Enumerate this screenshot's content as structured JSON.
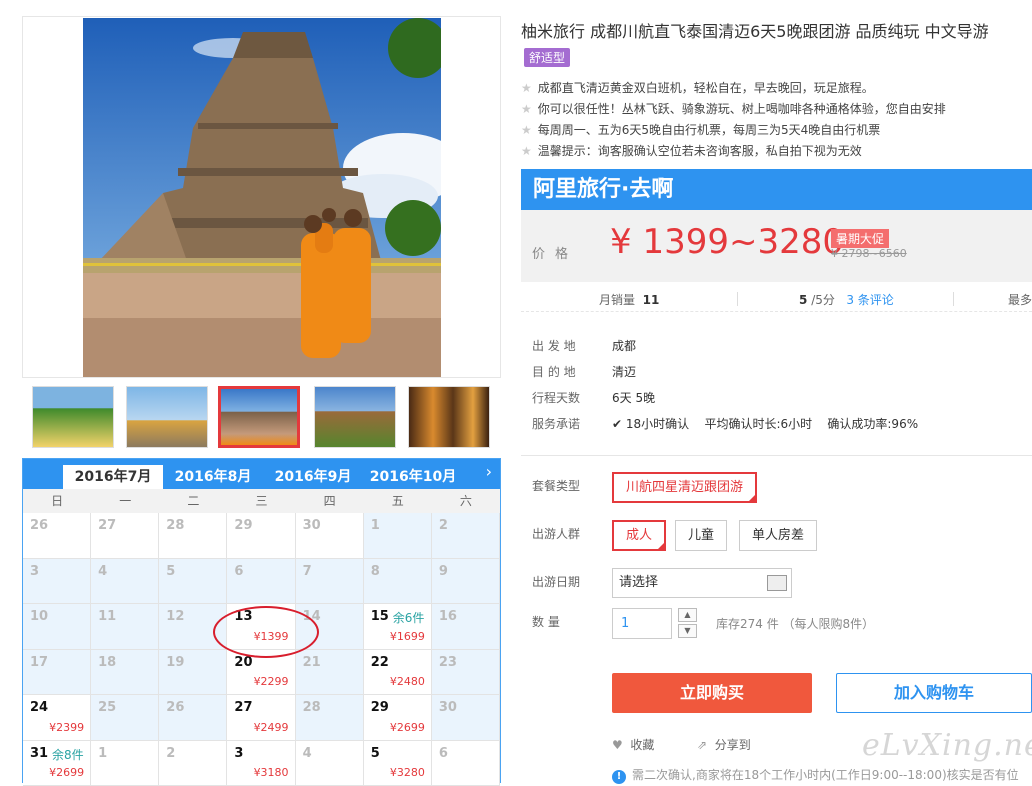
{
  "product": {
    "title": "柚米旅行 成都川航直飞泰国清迈6天5晚跟团游 品质纯玩 中文导游",
    "badge": "舒适型",
    "features": [
      "成都直飞清迈黄金双白班机，轻松自在，早去晚回，玩足旅程。",
      "你可以很任性！丛林飞跃、骑象游玩、树上喝咖啡各种通格体验，您自由安排",
      "每周周一、五为6天5晚自由行机票，每周三为5天4晚自由行机票",
      "温馨提示：询客服确认空位若未咨询客服，私自拍下视为无效"
    ]
  },
  "banner": {
    "brand": "阿里旅行·去啊"
  },
  "price": {
    "label": "价格",
    "range": "¥ 1399~3280",
    "promo": "暑期大促",
    "original": "¥ 2798~6560"
  },
  "stats": {
    "monthly_sales_label": "月销量",
    "monthly_sales": "11",
    "score": "5",
    "score_unit": "/5分",
    "reviews": "3 条评论",
    "more": "最多"
  },
  "details": [
    {
      "label": "出 发 地",
      "value": "成都"
    },
    {
      "label": "目 的 地",
      "value": "清迈"
    },
    {
      "label": "行程天数",
      "value": "6天 5晚"
    },
    {
      "label": "服务承诺",
      "value": "18小时确认"
    }
  ],
  "service_extra": [
    "平均确认时长:6小时",
    "确认成功率:96%"
  ],
  "options": {
    "package_label": "套餐类型",
    "package_value": "川航四星清迈跟团游",
    "people_label": "出游人群",
    "people": [
      "成人",
      "儿童",
      "单人房差"
    ],
    "date_label": "出游日期",
    "date_placeholder": "请选择",
    "qty_label": "数 量",
    "qty_value": "1",
    "stock": "库存274 件 （每人限购8件）"
  },
  "actions": {
    "buy": "立即购买",
    "cart": "加入购物车",
    "favorite": "收藏",
    "share": "分享到"
  },
  "notice": "需二次确认,商家将在18个工作小时内(工作日9:00--18:00)核实是否有位",
  "watermark": "eLvXing.net",
  "calendar": {
    "months": [
      "2016年7月",
      "2016年8月",
      "2016年9月",
      "2016年10月"
    ],
    "next": "›",
    "weekdays": [
      "日",
      "一",
      "二",
      "三",
      "四",
      "五",
      "六"
    ],
    "weeks": [
      [
        {
          "d": "26"
        },
        {
          "d": "27"
        },
        {
          "d": "28"
        },
        {
          "d": "29"
        },
        {
          "d": "30"
        },
        {
          "d": "1",
          "off": true
        },
        {
          "d": "2",
          "off": true
        }
      ],
      [
        {
          "d": "3",
          "off": true
        },
        {
          "d": "4",
          "off": true
        },
        {
          "d": "5",
          "off": true
        },
        {
          "d": "6",
          "off": true
        },
        {
          "d": "7",
          "off": true
        },
        {
          "d": "8",
          "off": true
        },
        {
          "d": "9",
          "off": true
        }
      ],
      [
        {
          "d": "10",
          "off": true
        },
        {
          "d": "11",
          "off": true
        },
        {
          "d": "12",
          "off": true
        },
        {
          "d": "13",
          "on": true,
          "price": "¥1399"
        },
        {
          "d": "14",
          "off": true
        },
        {
          "d": "15",
          "on": true,
          "stock": "余6件",
          "price": "¥1699"
        },
        {
          "d": "16",
          "off": true
        }
      ],
      [
        {
          "d": "17",
          "off": true
        },
        {
          "d": "18",
          "off": true
        },
        {
          "d": "19",
          "off": true
        },
        {
          "d": "20",
          "on": true,
          "price": "¥2299"
        },
        {
          "d": "21",
          "off": true
        },
        {
          "d": "22",
          "on": true,
          "price": "¥2480"
        },
        {
          "d": "23",
          "off": true
        }
      ],
      [
        {
          "d": "24",
          "on": true,
          "price": "¥2399"
        },
        {
          "d": "25",
          "off": true
        },
        {
          "d": "26",
          "off": true
        },
        {
          "d": "27",
          "on": true,
          "price": "¥2499"
        },
        {
          "d": "28",
          "off": true
        },
        {
          "d": "29",
          "on": true,
          "price": "¥2699"
        },
        {
          "d": "30",
          "off": true
        }
      ],
      [
        {
          "d": "31",
          "on": true,
          "stock": "余8件",
          "price": "¥2699"
        },
        {
          "d": "1"
        },
        {
          "d": "2"
        },
        {
          "d": "3",
          "on": true,
          "price": "¥3180"
        },
        {
          "d": "4"
        },
        {
          "d": "5",
          "on": true,
          "price": "¥3280"
        },
        {
          "d": "6"
        }
      ]
    ]
  },
  "colors": {
    "accent_red": "#e4393c",
    "brand_blue": "#2e93f0",
    "badge_purple": "#a46cd1"
  }
}
